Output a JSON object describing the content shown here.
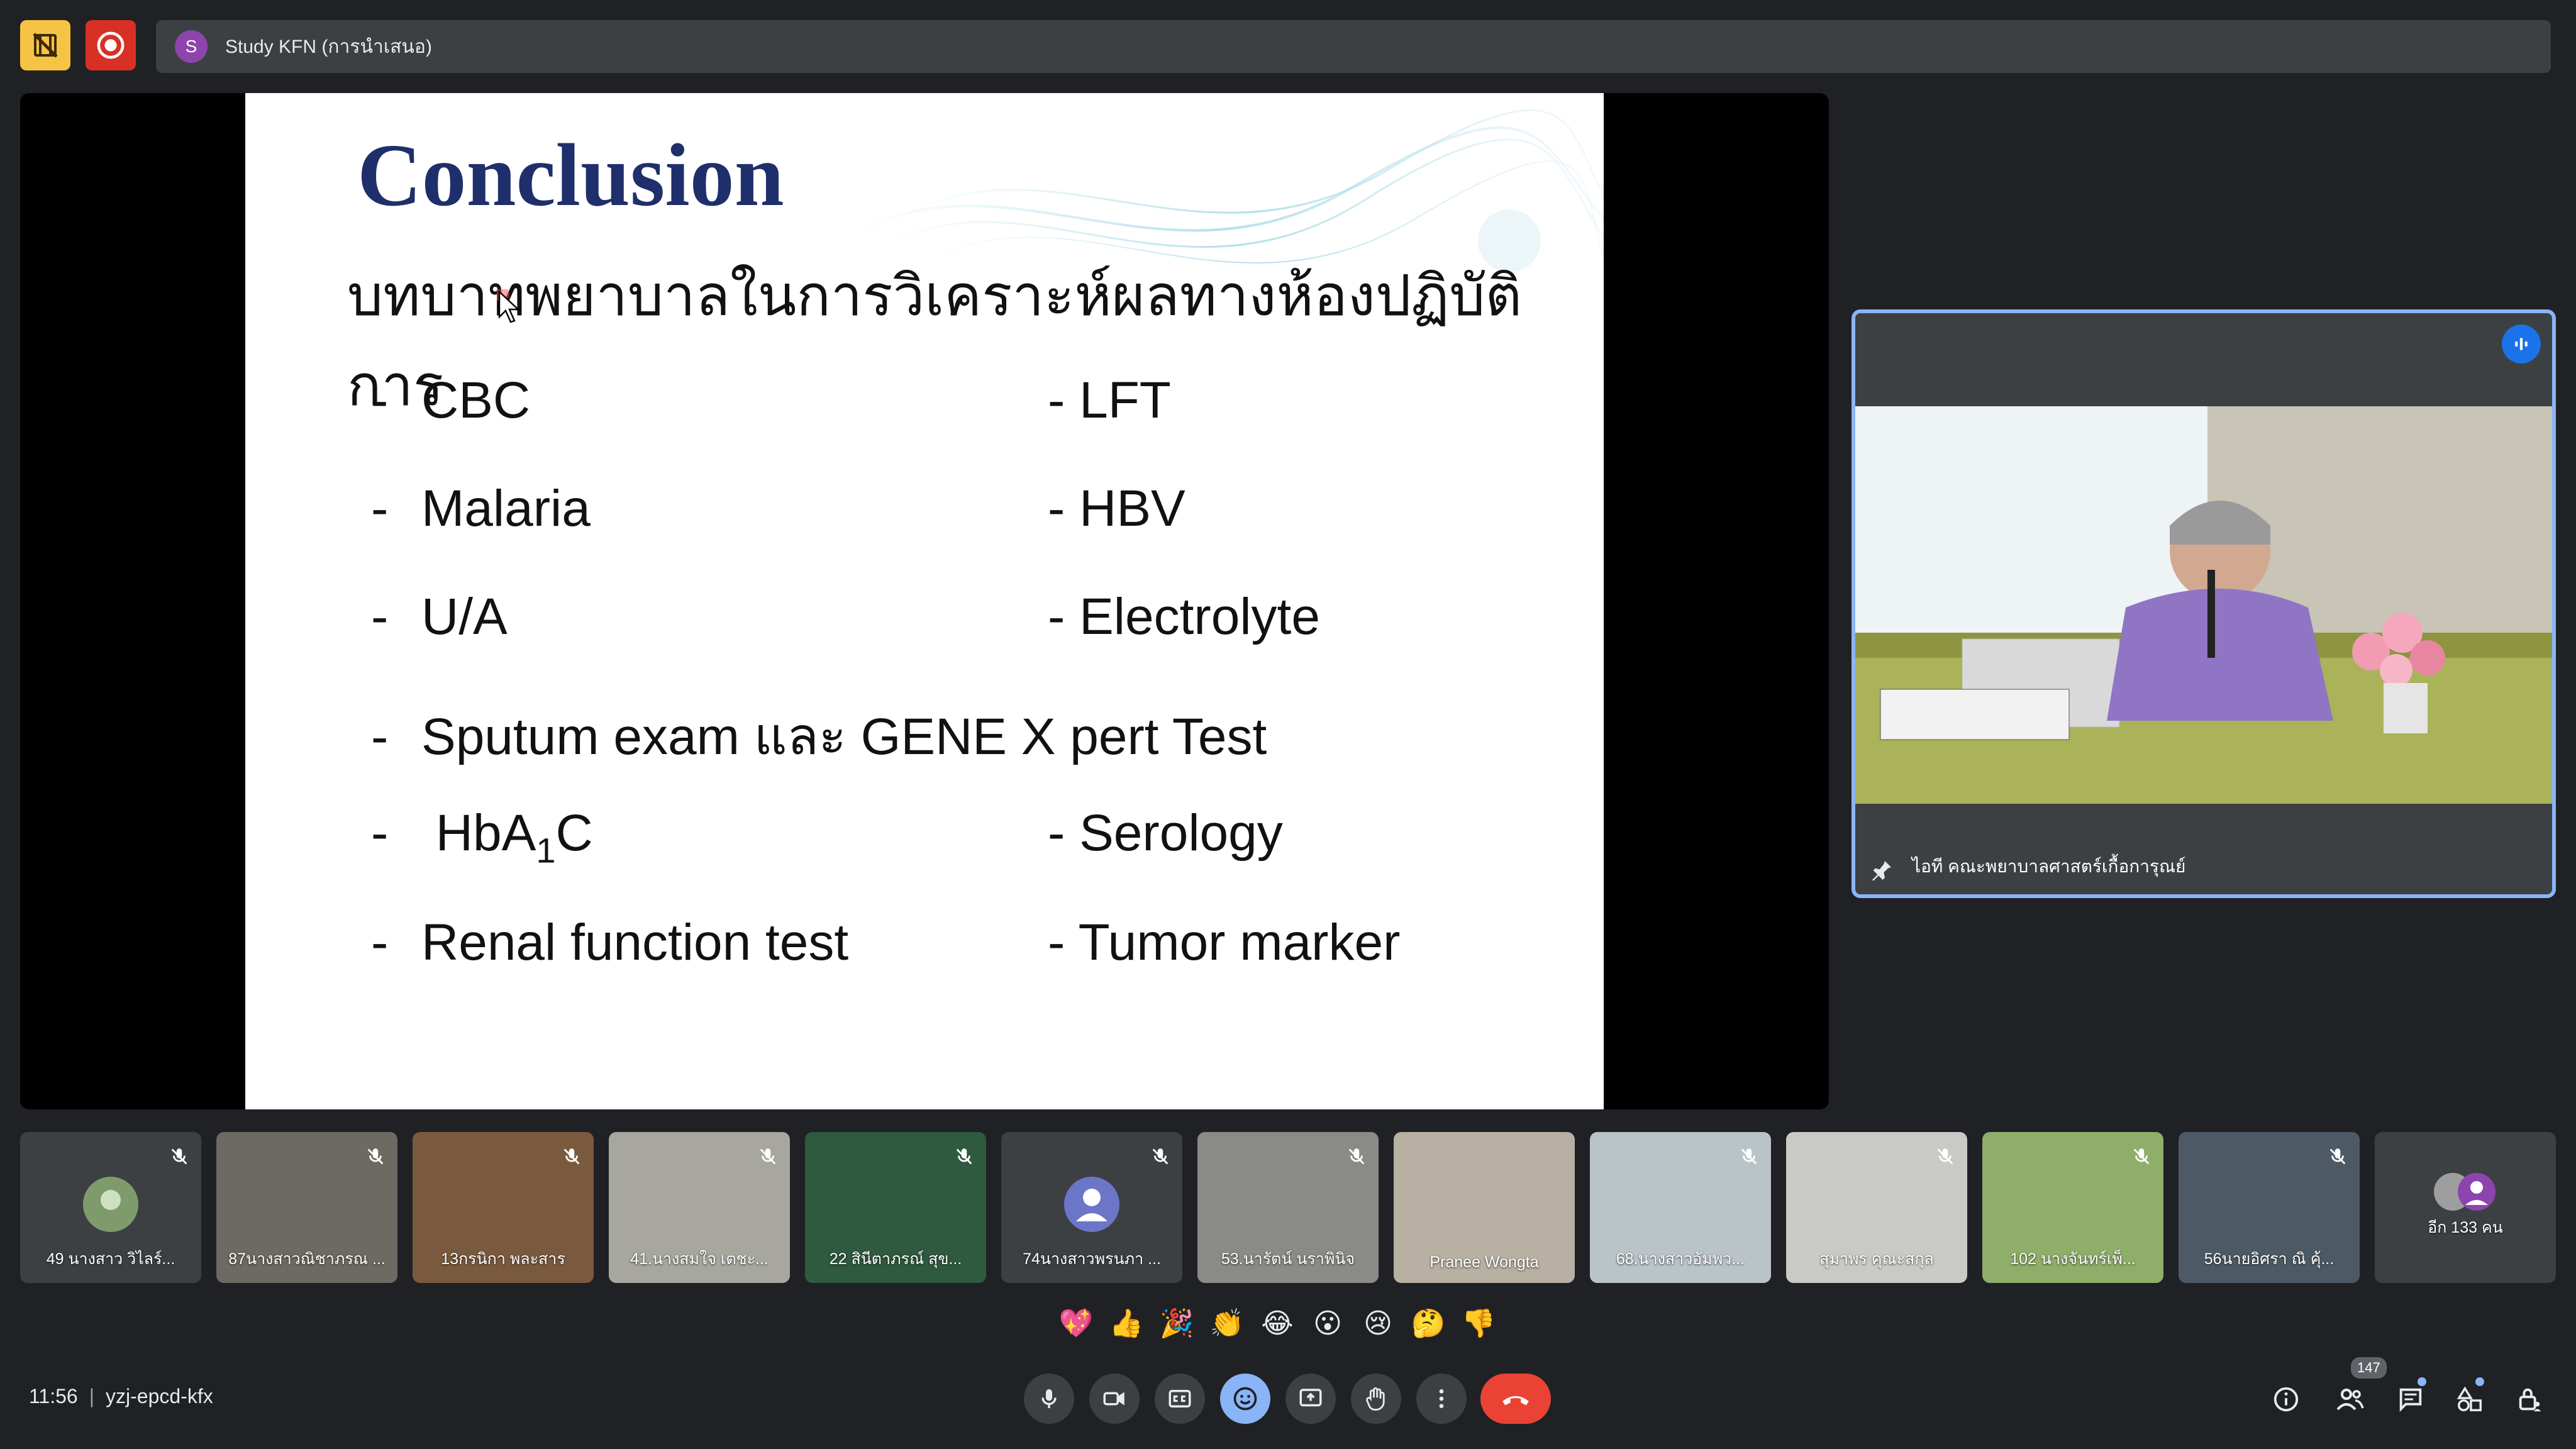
{
  "meeting": {
    "title": "Study KFN (การนำเสนอ)",
    "avatar_letter": "S",
    "time": "11:56",
    "separator": "|",
    "code": "yzj-epcd-kfx"
  },
  "slide": {
    "title": "Conclusion",
    "subtitle": "บทบาทพยาบาลในการวิเคราะห์ผลทางห้องปฏิบัติการ",
    "bullets_left": [
      "CBC",
      "Malaria",
      "U/A",
      "Sputum exam และ GENE X pert Test",
      "HbA",
      "Renal function test"
    ],
    "hba_subscript": "1",
    "hba_suffix": "C",
    "bullets_right": [
      "LFT",
      "HBV",
      "Electrolyte",
      "Serology",
      "Tumor marker"
    ],
    "dash": "-"
  },
  "speaker": {
    "name": "ไอที คณะพยาบาลศาสตร์เกื้อการุณย์"
  },
  "participants": [
    {
      "name": "49 นางสาว วิไลร์..."
    },
    {
      "name": "87นางสาวณิชาภรณ ..."
    },
    {
      "name": "13กรนิกา พละสาร"
    },
    {
      "name": "41.นางสมใจ เตชะ..."
    },
    {
      "name": "22 สินีตาภรณ์ สุข..."
    },
    {
      "name": "74นางสาวพรนภา ..."
    },
    {
      "name": "53.นารัตน์ นราพินิจ"
    },
    {
      "name": "Pranee Wongta"
    },
    {
      "name": "68.นางสาวอัมพว..."
    },
    {
      "name": "สุมาพร คุณะสกุล"
    },
    {
      "name": "102 นางจันทร์เพ็..."
    },
    {
      "name": "56นายอิศรา ณิ คุ้..."
    }
  ],
  "more_participants": "อีก 133 คน",
  "participant_count": "147",
  "reactions": [
    "💖",
    "👍",
    "🎉",
    "👏",
    "😂",
    "😮",
    "😢",
    "🤔",
    "👎"
  ],
  "colors": {
    "background": "#202124",
    "surface": "#3c4043",
    "accent": "#8ab4f8",
    "danger": "#ea4335",
    "slide_title": "#1f2f6b"
  }
}
